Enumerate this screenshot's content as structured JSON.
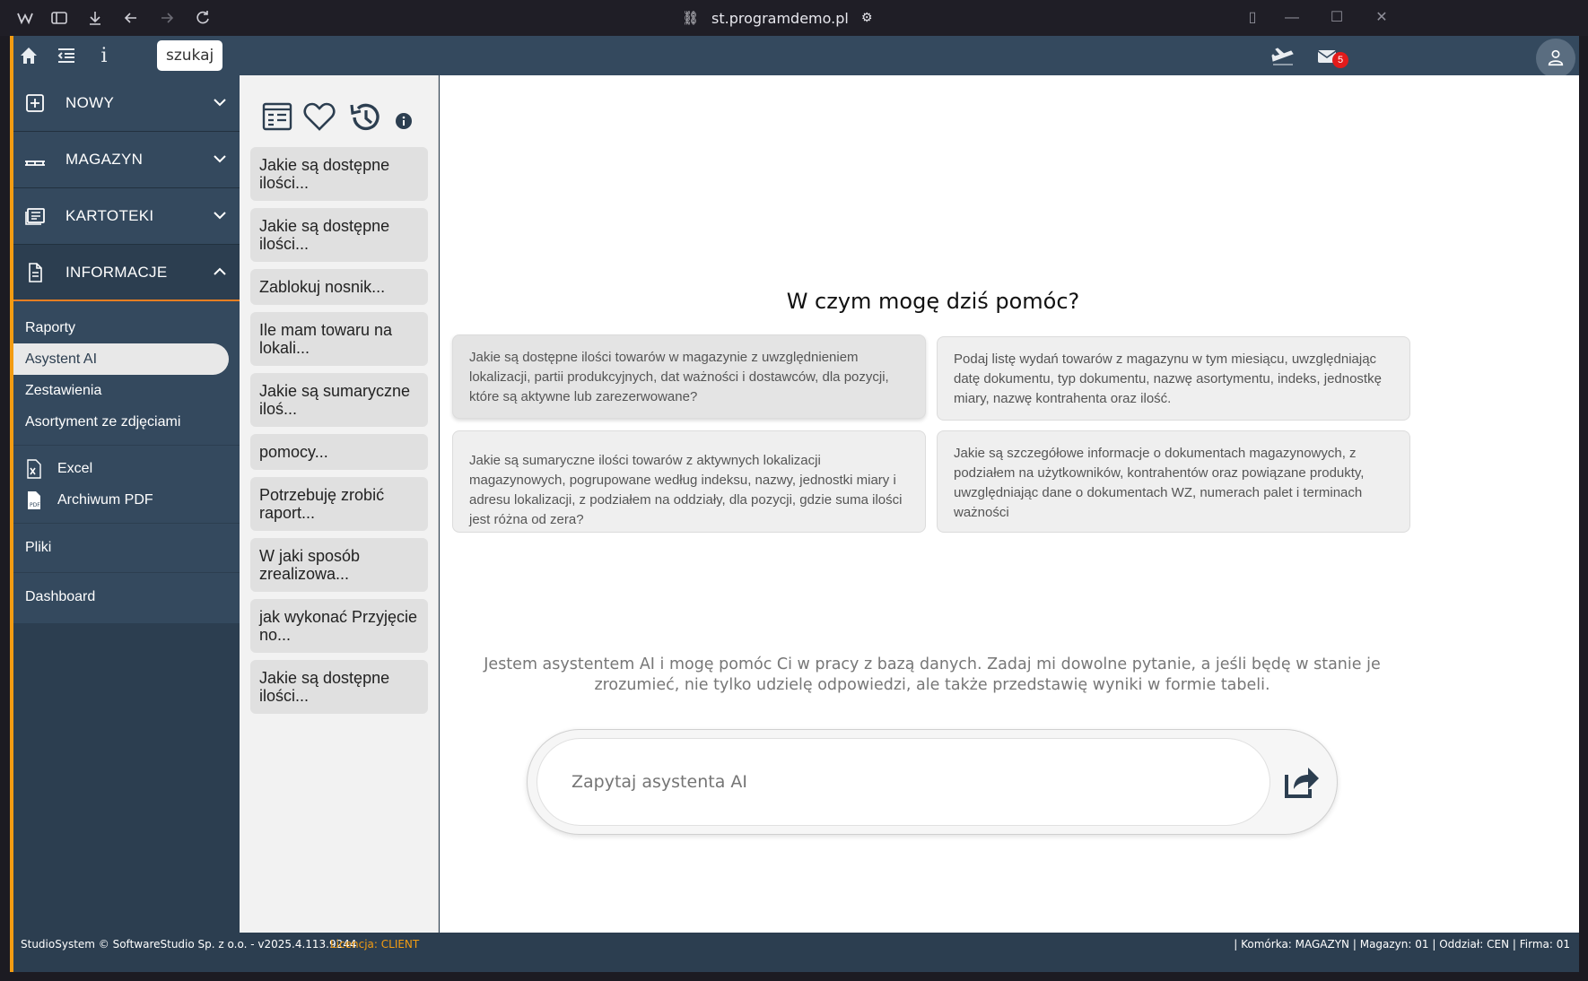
{
  "browser": {
    "url": "st.programdemo.pl"
  },
  "topbar": {
    "search_label": "szukaj",
    "mail_count": "5"
  },
  "sidebar": {
    "groups": [
      {
        "label": "NOWY",
        "icon": "plus-square-icon"
      },
      {
        "label": "MAGAZYN",
        "icon": "pallet-icon"
      },
      {
        "label": "KARTOTEKI",
        "icon": "cards-icon"
      },
      {
        "label": "INFORMACJE",
        "icon": "document-icon"
      }
    ],
    "info_items": [
      "Raporty",
      "Asystent AI",
      "Zestawienia",
      "Asortyment ze zdjęciami"
    ],
    "export_items": [
      "Excel",
      "Archiwum PDF"
    ],
    "pliki": "Pliki",
    "dashboard": "Dashboard"
  },
  "history": {
    "items": [
      "Jakie są dostępne ilości...",
      "Jakie są dostępne ilości...",
      "Zablokuj nosnik...",
      "Ile mam towaru na lokali...",
      "Jakie są sumaryczne iloś...",
      "pomocy...",
      "Potrzebuję zrobić raport...",
      "W jaki sposób zrealizowa...",
      "jak wykonać Przyjęcie no...",
      "Jakie są dostępne ilości..."
    ]
  },
  "main": {
    "title": "W czym mogę dziś pomóc?",
    "cards": [
      "Jakie są dostępne ilości towarów w magazynie z uwzględnieniem lokalizacji, partii produkcyjnych, dat ważności i dostawców, dla pozycji, które są aktywne lub zarezerwowane?",
      "Podaj listę wydań towarów z magazynu w tym miesiącu, uwzględniając datę dokumentu, typ dokumentu, nazwę asortymentu, indeks, jednostkę miary, nazwę kontrahenta oraz ilość.",
      "Jakie są sumaryczne ilości towarów z aktywnych lokalizacji magazynowych, pogrupowane według indeksu, nazwy, jednostki miary i adresu lokalizacji, z podziałem na oddziały, dla pozycji, gdzie suma ilości jest różna od zera?",
      "Jakie są szczegółowe informacje o dokumentach magazynowych, z podziałem na użytkowników, kontrahentów oraz powiązane produkty, uwzględniając dane o dokumentach WZ, numerach palet i terminach ważności"
    ],
    "intro": "Jestem asystentem AI i mogę pomóc Ci w pracy z bazą danych. Zadaj mi dowolne pytanie, a jeśli będę w stanie je zrozumieć, nie tylko udzielę odpowiedzi, ale także przedstawię wyniki w formie tabeli.",
    "input_placeholder": "Zapytaj asystenta AI"
  },
  "footer": {
    "left": "StudioSystem © SoftwareStudio Sp. z o.o. - v2025.4.113.9244",
    "license": "Licencja: CLIENT",
    "right": "| Komórka: MAGAZYN | Magazyn: 01 | Oddział: CEN | Firma: 01"
  }
}
